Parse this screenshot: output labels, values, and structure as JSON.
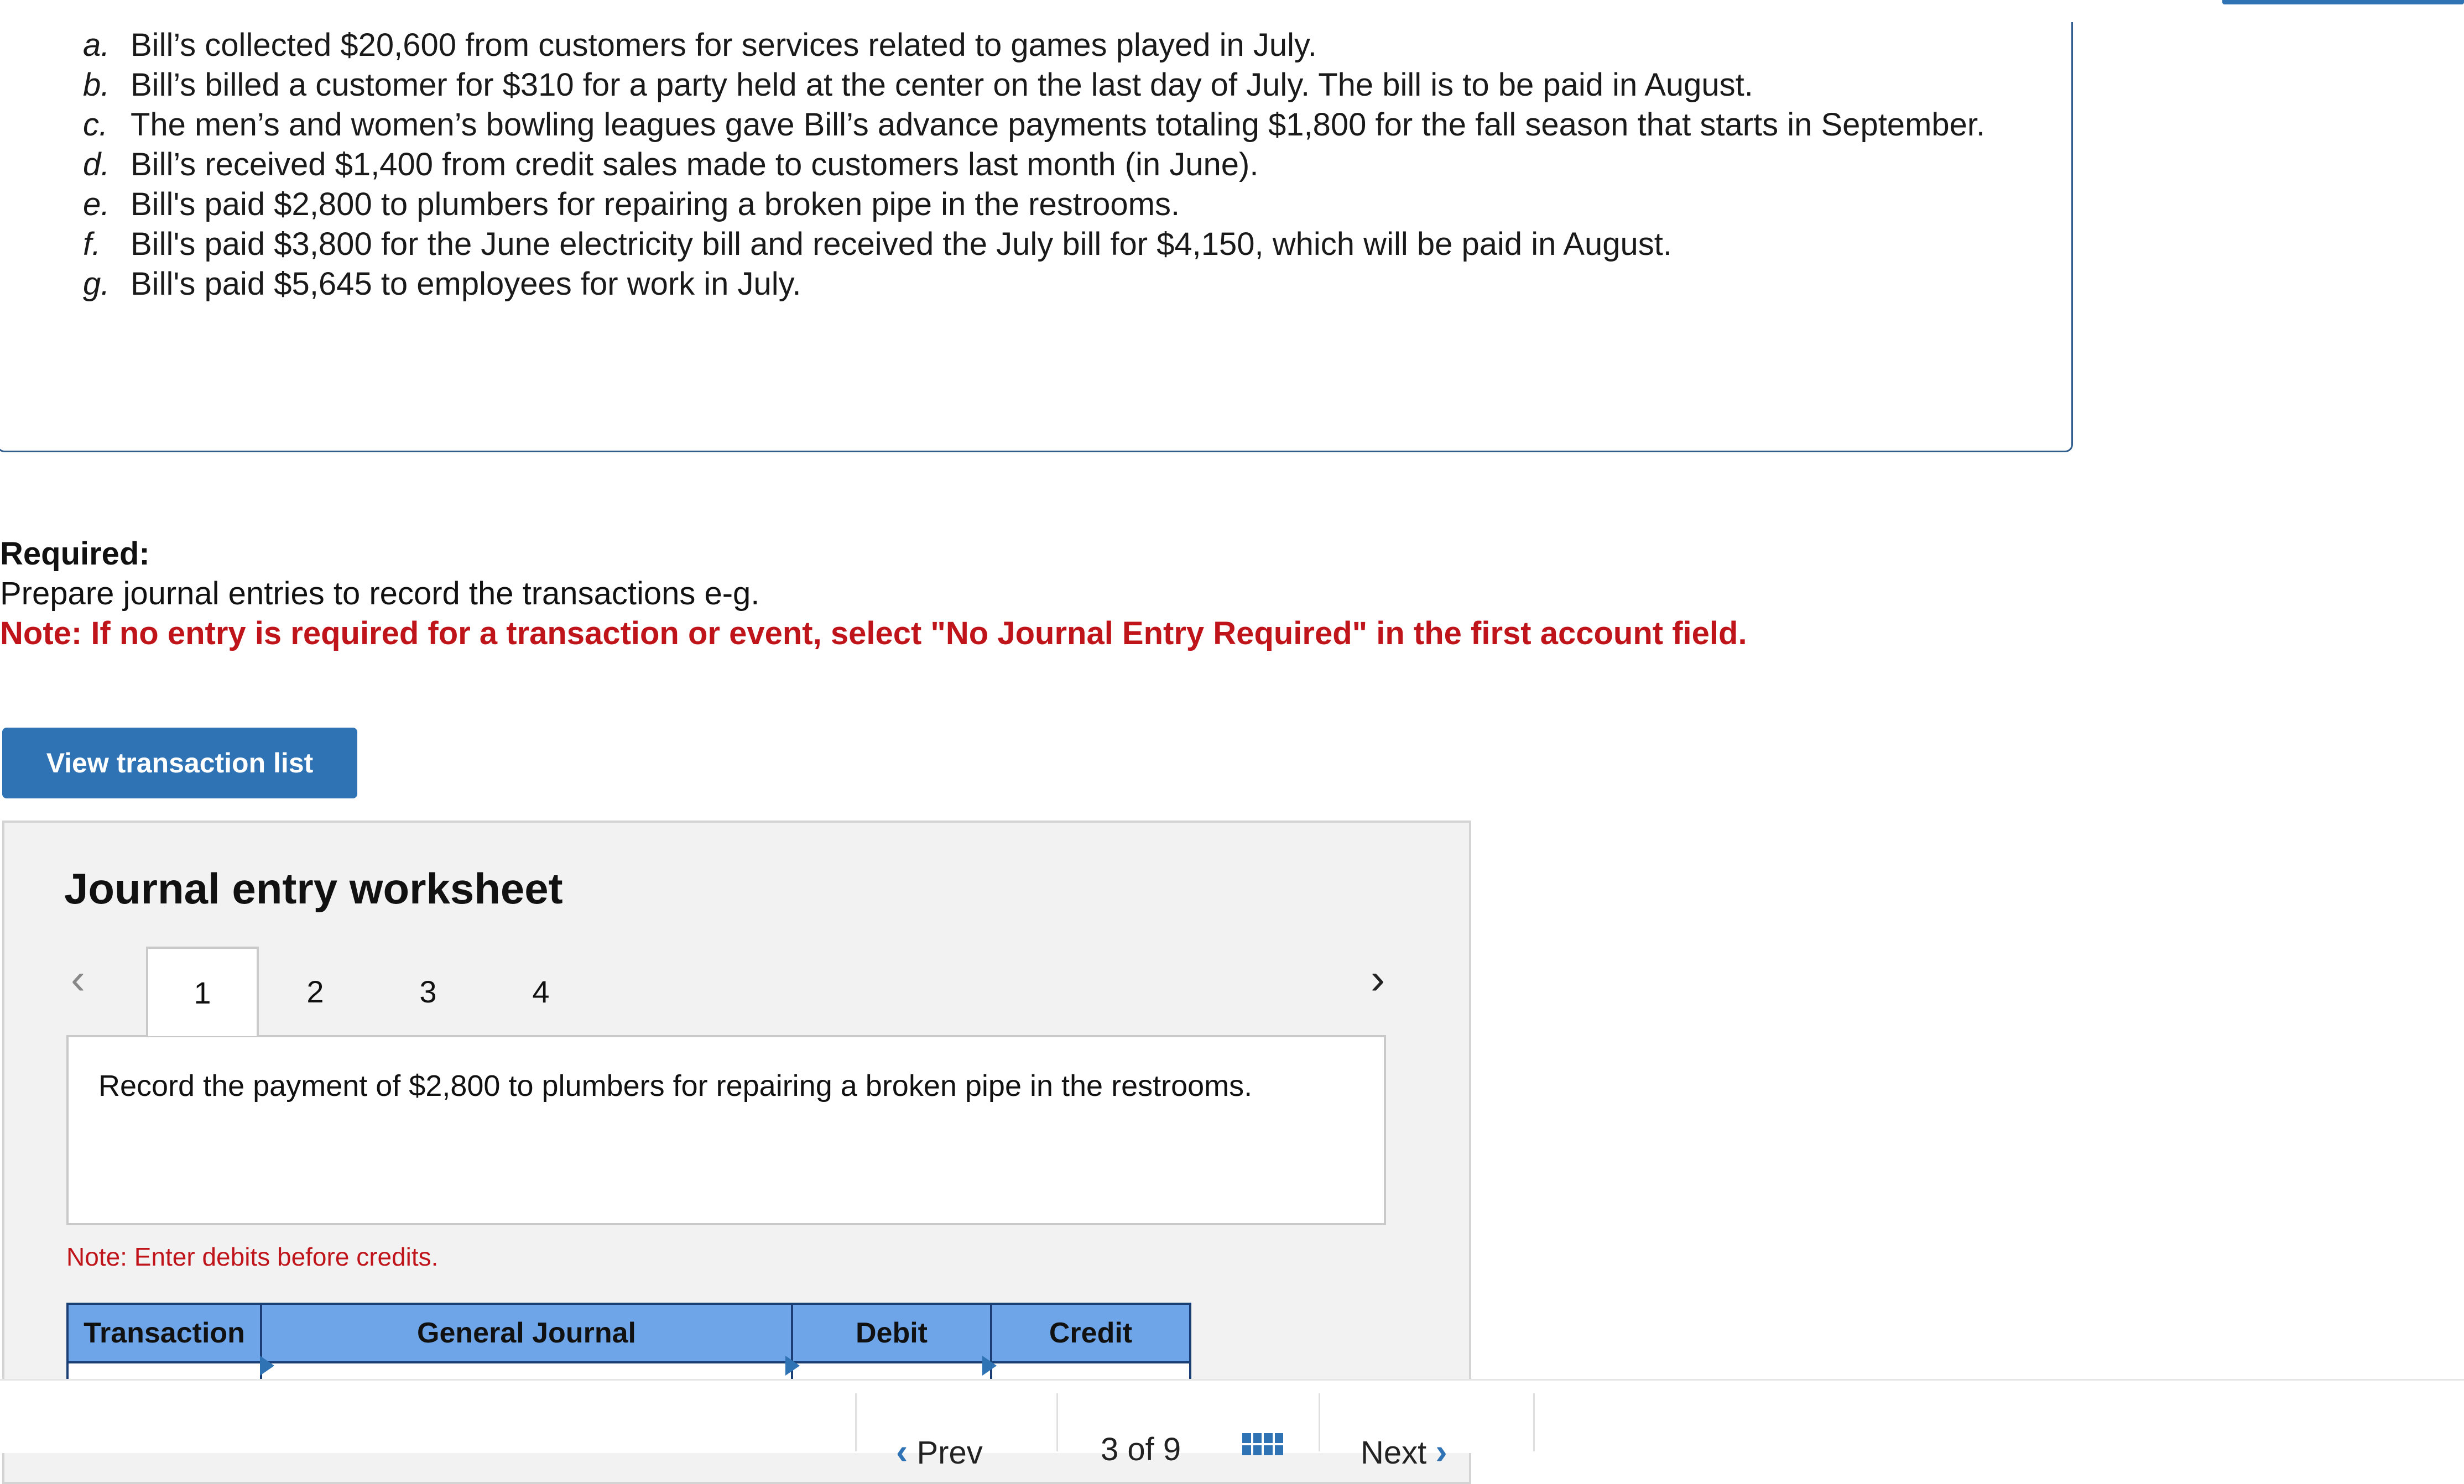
{
  "transactions": [
    {
      "letter": "a.",
      "text": "Bill’s collected $20,600 from customers for services related to games played in July."
    },
    {
      "letter": "b.",
      "text": "Bill’s billed a customer for $310 for a party held at the center on the last day of July. The bill is to be paid in August."
    },
    {
      "letter": "c.",
      "text": "The men’s and women’s bowling leagues gave Bill’s advance payments totaling $1,800 for the fall season that starts in September."
    },
    {
      "letter": "d.",
      "text": "Bill’s received $1,400 from credit sales made to customers last month (in June)."
    },
    {
      "letter": "e.",
      "text": "Bill's paid $2,800 to plumbers for repairing a broken pipe in the restrooms."
    },
    {
      "letter": "f.",
      "text": "Bill's paid $3,800 for the June electricity bill and received the July bill for $4,150, which will be paid in August."
    },
    {
      "letter": "g.",
      "text": "Bill's paid $5,645 to employees for work in July."
    }
  ],
  "required": {
    "title": "Required:",
    "text": "Prepare journal entries to record the transactions e-g.",
    "note": "Note: If no entry is required for a transaction or event, select \"No Journal Entry Required\" in the first account field."
  },
  "view_button": "View transaction list",
  "worksheet": {
    "title": "Journal entry worksheet",
    "tabs": [
      "1",
      "2",
      "3",
      "4"
    ],
    "active_tab": "1",
    "instruction": "Record the payment of $2,800 to plumbers for repairing a broken pipe in the restrooms.",
    "note": "Note: Enter debits before credits.",
    "columns": [
      "Transaction",
      "General Journal",
      "Debit",
      "Credit"
    ]
  },
  "footer": {
    "prev_label": "Prev",
    "page_current": "3",
    "page_of": "of",
    "page_total": "9",
    "next_label": "Next"
  },
  "colors": {
    "accent": "#2f73b5",
    "note_red": "#c0141b",
    "table_header": "#6ea5e8",
    "table_border": "#1b3e74"
  },
  "icons": [
    "chevron-left-icon",
    "chevron-right-icon",
    "grid-icon"
  ]
}
